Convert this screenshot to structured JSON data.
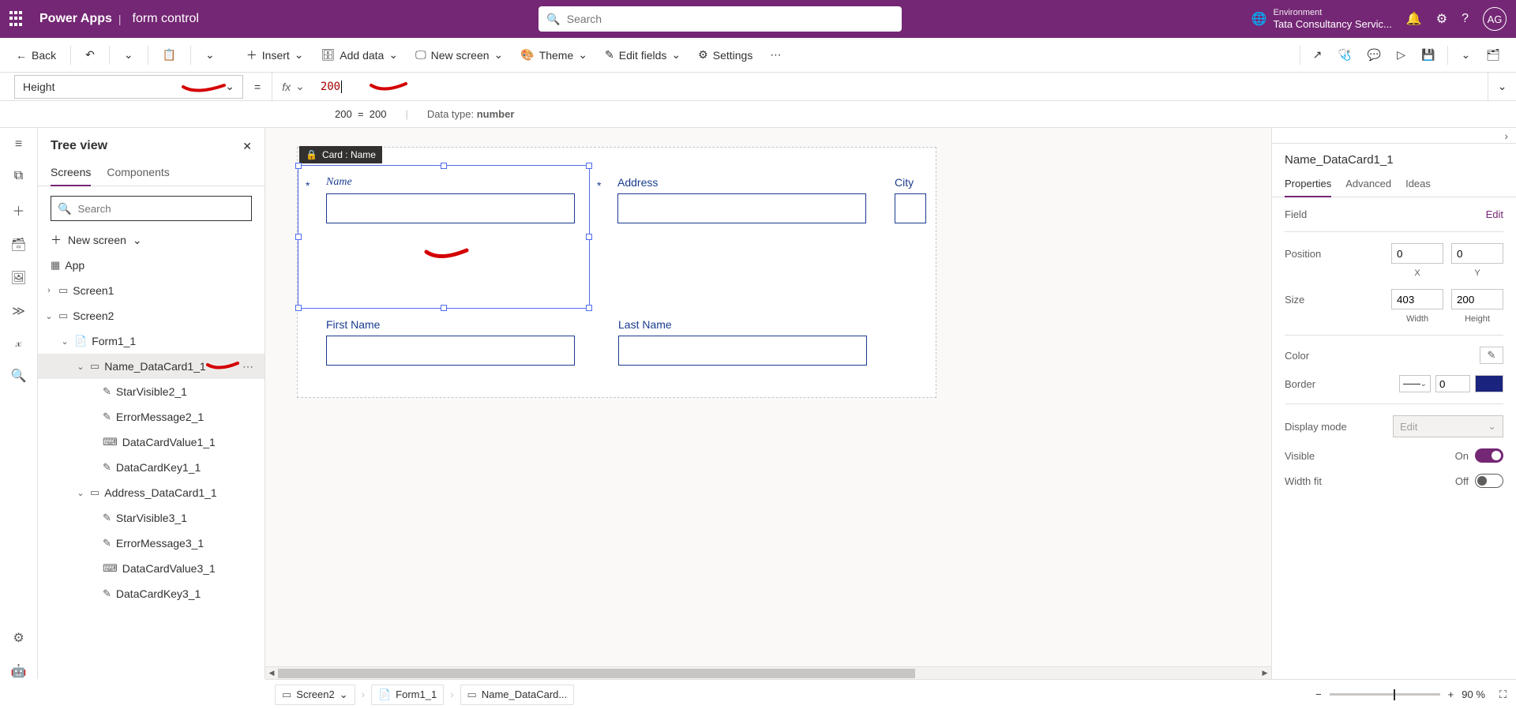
{
  "header": {
    "app": "Power Apps",
    "subtitle": "form control",
    "search_placeholder": "Search",
    "env_label": "Environment",
    "env_value": "Tata Consultancy Servic...",
    "avatar": "AG"
  },
  "cmd": {
    "back": "Back",
    "insert": "Insert",
    "addData": "Add data",
    "newScreen": "New screen",
    "theme": "Theme",
    "editFields": "Edit fields",
    "settings": "Settings"
  },
  "formula": {
    "property": "Height",
    "fx": "fx",
    "value": "200",
    "resultL": "200",
    "resultEq": "=",
    "resultR": "200",
    "typeLabel": "Data type: ",
    "typeVal": "number"
  },
  "tree": {
    "title": "Tree view",
    "tabs": {
      "screens": "Screens",
      "components": "Components"
    },
    "search_placeholder": "Search",
    "new_screen": "New screen",
    "items": {
      "app": "App",
      "screen1": "Screen1",
      "screen2": "Screen2",
      "form1": "Form1_1",
      "nameCard": "Name_DataCard1_1",
      "star2": "StarVisible2_1",
      "err2": "ErrorMessage2_1",
      "val1": "DataCardValue1_1",
      "key1": "DataCardKey1_1",
      "addrCard": "Address_DataCard1_1",
      "star3": "StarVisible3_1",
      "err3": "ErrorMessage3_1",
      "val3": "DataCardValue3_1",
      "key3": "DataCardKey3_1"
    }
  },
  "canvas": {
    "cardTag": "Card : Name",
    "labels": {
      "name": "Name",
      "address": "Address",
      "city": "City",
      "first": "First Name",
      "last": "Last Name"
    }
  },
  "props": {
    "selected": "Name_DataCard1_1",
    "tabs": {
      "properties": "Properties",
      "advanced": "Advanced",
      "ideas": "Ideas"
    },
    "labels": {
      "field": "Field",
      "edit": "Edit",
      "position": "Position",
      "x": "X",
      "y": "Y",
      "size": "Size",
      "width": "Width",
      "height": "Height",
      "color": "Color",
      "border": "Border",
      "displayMode": "Display mode",
      "displayModeVal": "Edit",
      "visible": "Visible",
      "on": "On",
      "widthFit": "Width fit",
      "off": "Off"
    },
    "values": {
      "posX": "0",
      "posY": "0",
      "w": "403",
      "h": "200",
      "borderNum": "0"
    }
  },
  "bottom": {
    "screen": "Screen2",
    "form": "Form1_1",
    "card": "Name_DataCard...",
    "zoom": "90  %"
  }
}
